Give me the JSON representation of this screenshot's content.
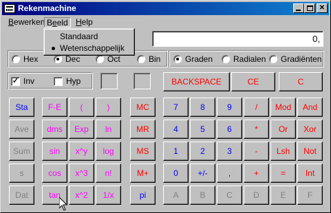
{
  "window": {
    "title": "Rekenmachine"
  },
  "menu": {
    "items": [
      {
        "label": "Bewerken",
        "accel": "B"
      },
      {
        "label": "Beeld",
        "accel": "e"
      },
      {
        "label": "Help",
        "accel": "H"
      }
    ],
    "dropdown": [
      {
        "label": "Standaard",
        "checked": false
      },
      {
        "label": "Wetenschappelijk",
        "checked": true
      }
    ]
  },
  "display": {
    "value": "0,"
  },
  "number_system": {
    "options": [
      "Hex",
      "Dec",
      "Oct",
      "Bin"
    ],
    "selected": "Dec"
  },
  "angle_mode": {
    "options": [
      "Graden",
      "Radialen",
      "Gradiënten"
    ],
    "selected": "Graden"
  },
  "modifiers": {
    "inv": {
      "label": "Inv",
      "checked": true
    },
    "hyp": {
      "label": "Hyp",
      "checked": false
    }
  },
  "edit_buttons": {
    "backspace": "BACKSPACE",
    "ce": "CE",
    "c": "C"
  },
  "keypad": {
    "col_stat": [
      "Sta",
      "Ave",
      "Sum",
      "s",
      "Dat"
    ],
    "col_fn1": [
      "F-E",
      "dms",
      "sin",
      "cos",
      "tan"
    ],
    "col_fn2": [
      "(",
      "Exp",
      "x^y",
      "x^3",
      "x^2"
    ],
    "col_fn3": [
      ")",
      "ln",
      "log",
      "n!",
      "1/x"
    ],
    "col_mem": [
      "MC",
      "MR",
      "MS",
      "M+",
      "pi"
    ],
    "digits": [
      [
        "7",
        "8",
        "9",
        "/",
        "Mod",
        "And"
      ],
      [
        "4",
        "5",
        "6",
        "*",
        "Or",
        "Xor"
      ],
      [
        "1",
        "2",
        "3",
        "-",
        "Lsh",
        "Not"
      ],
      [
        "0",
        "+/-",
        ",",
        "+",
        "=",
        "Int"
      ],
      [
        "A",
        "B",
        "C",
        "D",
        "E",
        "F"
      ]
    ]
  }
}
